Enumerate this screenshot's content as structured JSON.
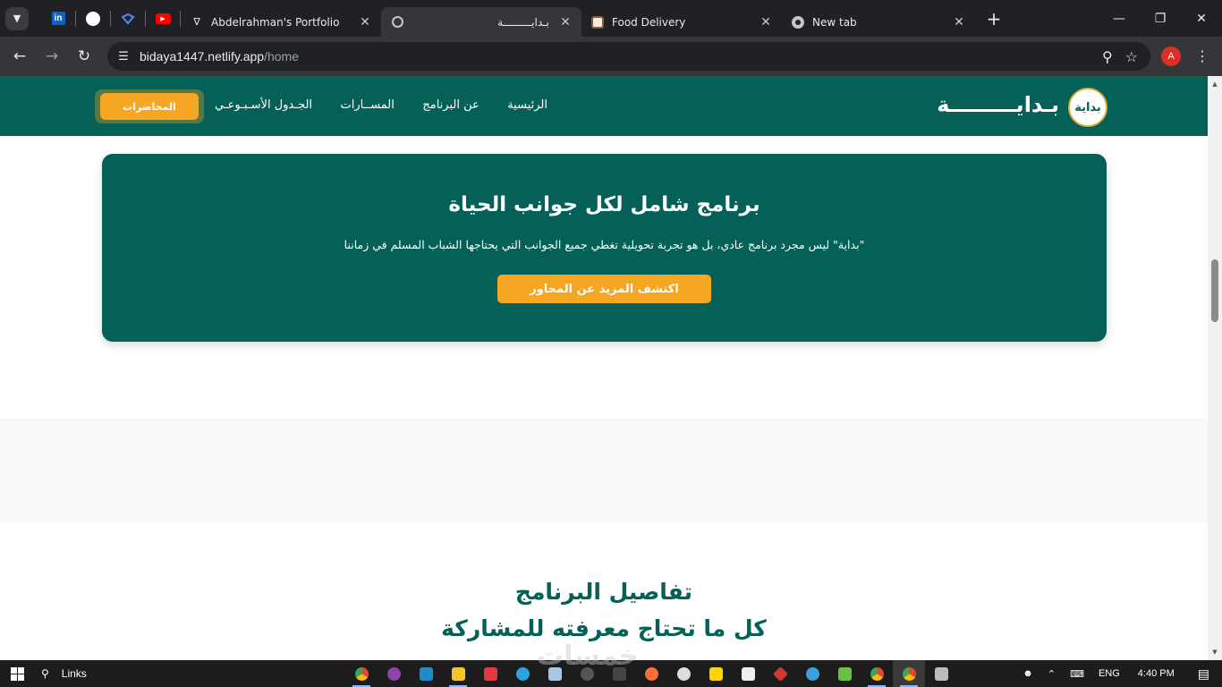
{
  "browser": {
    "pinned_tabs": [
      "linkedin-icon",
      "github-icon",
      "drawio-icon",
      "youtube-icon"
    ],
    "tabs": [
      {
        "title": "Abdelrahman's Portfolio",
        "icon": "portfolio-favicon"
      },
      {
        "title": "بـدايـــــــــة",
        "icon": "globe-icon",
        "active": true
      },
      {
        "title": "Food Delivery",
        "icon": "food-favicon"
      },
      {
        "title": "New tab",
        "icon": "chrome-icon"
      }
    ],
    "new_tab": "+",
    "url_host": "bidaya1447.netlify.app",
    "url_path": "/home",
    "profile_initial": "A"
  },
  "site": {
    "logo_badge": "بداية",
    "logo_text": "بـدايـــــــــة",
    "nav": [
      "الرئيسية",
      "عن البرنامج",
      "المســارات",
      "الجـدول الأسـبـوعـي"
    ],
    "lectures_button": "المحاضرات"
  },
  "hero": {
    "title": "برنامج شامل لكل جوانب الحياة",
    "description": "\"بداية\" ليس مجرد برنامج عادي، بل هو تجربة تحويلية تغطي جميع الجوانب التي يحتاجها الشباب المسلم في زماننا",
    "button": "اكتشف المزيد عن المحاور"
  },
  "details": {
    "title": "تفاصيل البرنامج",
    "subtitle": "كل ما تحتاج معرفته للمشاركة"
  },
  "taskbar": {
    "search_label": "Links",
    "language": "ENG",
    "time": "4:40 PM"
  },
  "watermark": "خمسات",
  "colors": {
    "brand_green": "#056157",
    "accent_orange": "#f5a623"
  }
}
